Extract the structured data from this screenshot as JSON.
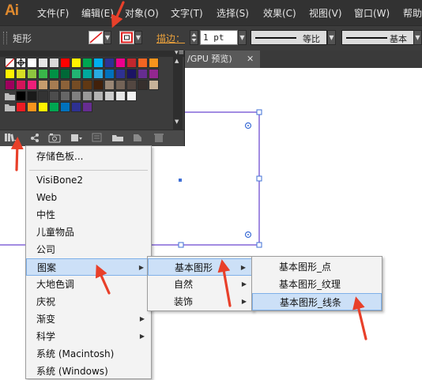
{
  "app": {
    "logo": "Ai"
  },
  "menubar": [
    "文件(F)",
    "编辑(E)",
    "对象(O)",
    "文字(T)",
    "选择(S)",
    "效果(C)",
    "视图(V)",
    "窗口(W)",
    "帮助"
  ],
  "controlbar": {
    "tool_name": "矩形",
    "stroke_label": "描边：",
    "stroke_value": "1 pt",
    "profile_label": "等比",
    "brush_label": "基本"
  },
  "document": {
    "tab_label": "/GPU 预览)",
    "close": "✕"
  },
  "swatch_colors": [
    [
      "#ffffff",
      "#000000",
      "#ffffff",
      "#e6e6e6",
      "#d9d9d9",
      "#ff0000",
      "#fff200",
      "#00a651",
      "#00aeef",
      "#2e3192",
      "#ec008c",
      "#c1272d",
      "#f26522",
      "#f7941d"
    ],
    [
      "#fff200",
      "#d7df23",
      "#8dc63f",
      "#39b54a",
      "#009245",
      "#006837",
      "#22b573",
      "#00a99d",
      "#29abe2",
      "#0071bc",
      "#2e3192",
      "#1b1464",
      "#662d91",
      "#93278f"
    ],
    [
      "#9e005d",
      "#d4145a",
      "#ed1e79",
      "#c69c6d",
      "#a67c52",
      "#8c6239",
      "#754c24",
      "#603813",
      "#42210b",
      "#998675",
      "#736357",
      "#534741",
      "#362f2d",
      "#c7b299"
    ],
    [
      "#000000",
      "#1a1a1a",
      "#333333",
      "#4d4d4d",
      "#666666",
      "#808080",
      "#999999",
      "#b3b3b3",
      "#cccccc",
      "#e6e6e6",
      "#f2f2f2"
    ],
    [
      "#ed1c24",
      "#f7941d",
      "#fff200",
      "#00a651",
      "#0072bc",
      "#2e3192",
      "#662d91"
    ]
  ],
  "library_menu": {
    "items": [
      "存储色板...",
      "VisiBone2",
      "Web",
      "中性",
      "儿童物品",
      "公司",
      "图案",
      "大地色调",
      "庆祝",
      "渐变",
      "科学",
      "系统 (Macintosh)",
      "系统 (Windows)"
    ]
  },
  "pattern_menu": {
    "items": [
      "基本图形",
      "自然",
      "装饰"
    ]
  },
  "basic_shapes_menu": {
    "items": [
      "基本图形_点",
      "基本图形_纹理",
      "基本图形_线条"
    ]
  },
  "colors": {
    "menubar_bg": "#323232",
    "panel_bg": "#3c3c3c",
    "highlight": "#cce0f7",
    "annotation": "#e8402a",
    "selection": "#7b5bd6",
    "stroke_label": "#e8a03c"
  }
}
